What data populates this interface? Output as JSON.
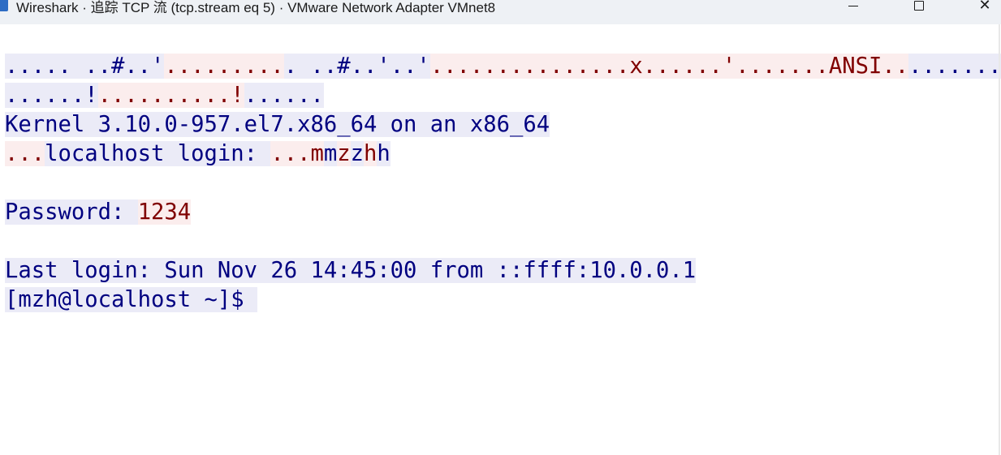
{
  "window": {
    "title": "Wireshark · 追踪 TCP 流 (tcp.stream eq 5) · VMware Network Adapter VMnet8",
    "controls": {
      "minimize": "minimize",
      "maximize": "maximize",
      "close": "✕"
    }
  },
  "colors": {
    "client_fg": "#000080",
    "client_bg": "#ebebf7",
    "server_fg": "#800000",
    "server_bg": "#fbeded"
  },
  "stream": {
    "lines": [
      [
        {
          "dir": "client",
          "text": "..... ..#..'"
        },
        {
          "dir": "server",
          "text": "........."
        },
        {
          "dir": "client",
          "text": ". ..#..'..'"
        },
        {
          "dir": "server",
          "text": "..........."
        },
        {
          "dir": "server",
          "text": "....x......'.......ANSI.."
        },
        {
          "dir": "client",
          "text": "......."
        }
      ],
      [
        {
          "dir": "client",
          "text": "......!"
        },
        {
          "dir": "server",
          "text": "..........!"
        },
        {
          "dir": "client",
          "text": "......"
        }
      ],
      [
        {
          "dir": "client",
          "text": "Kernel 3.10.0-957.el7.x86_64 on an x86_64"
        }
      ],
      [
        {
          "dir": "server",
          "text": "..."
        },
        {
          "dir": "client",
          "text": "localhost login: "
        },
        {
          "dir": "server",
          "text": "...m"
        },
        {
          "dir": "client",
          "text": "m"
        },
        {
          "dir": "server",
          "text": "z"
        },
        {
          "dir": "client",
          "text": "z"
        },
        {
          "dir": "server",
          "text": "h"
        },
        {
          "dir": "client",
          "text": "h"
        }
      ],
      [],
      [
        {
          "dir": "client",
          "text": "Password: "
        },
        {
          "dir": "server",
          "text": "1234"
        }
      ],
      [],
      [
        {
          "dir": "client",
          "text": "Last login: Sun Nov 26 14:45:00 from ::ffff:10.0.0.1"
        }
      ],
      [
        {
          "dir": "client",
          "text": "[mzh@localhost ~]$ "
        }
      ]
    ]
  }
}
